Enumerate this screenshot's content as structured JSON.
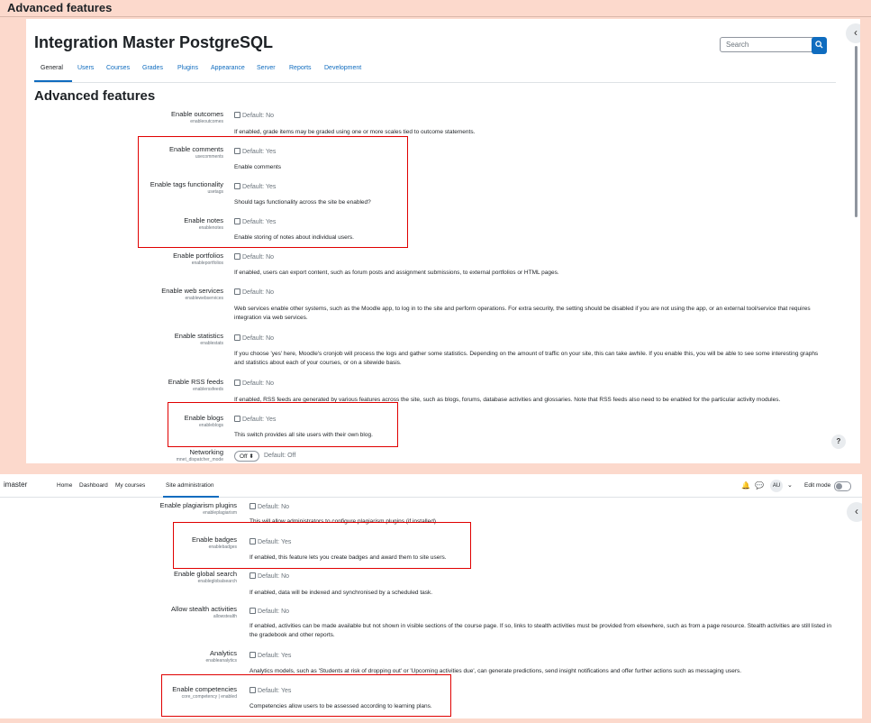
{
  "window_title": "Advanced features",
  "top": {
    "site_title": "Integration Master PostgreSQL",
    "search_placeholder": "Search",
    "tabs": [
      {
        "label": "General"
      },
      {
        "label": "Users"
      },
      {
        "label": "Courses"
      },
      {
        "label": "Grades"
      },
      {
        "label": "Plugins"
      },
      {
        "label": "Appearance"
      },
      {
        "label": "Server"
      },
      {
        "label": "Reports"
      },
      {
        "label": "Development"
      }
    ],
    "page_heading": "Advanced features",
    "settings": [
      {
        "label": "Enable outcomes",
        "key": "enableoutcomes",
        "default": "Default: No",
        "desc": "If enabled, grade items may be graded using one or more scales tied to outcome statements."
      },
      {
        "label": "Enable comments",
        "key": "usecomments",
        "default": "Default: Yes",
        "desc": "Enable comments"
      },
      {
        "label": "Enable tags functionality",
        "key": "usetags",
        "default": "Default: Yes",
        "desc": "Should tags functionality across the site be enabled?"
      },
      {
        "label": "Enable notes",
        "key": "enablenotes",
        "default": "Default: Yes",
        "desc": "Enable storing of notes about individual users."
      },
      {
        "label": "Enable portfolios",
        "key": "enableportfolios",
        "default": "Default: No",
        "desc": "If enabled, users can export content, such as forum posts and assignment submissions, to external portfolios or HTML pages."
      },
      {
        "label": "Enable web services",
        "key": "enablewebservices",
        "default": "Default: No",
        "desc": "Web services enable other systems, such as the Moodle app, to log in to the site and perform operations. For extra security, the setting should be disabled if you are not using the app, or an external tool/service that requires integration via web services."
      },
      {
        "label": "Enable statistics",
        "key": "enablestats",
        "default": "Default: No",
        "desc": "If you choose 'yes' here, Moodle's cronjob will process the logs and gather some statistics. Depending on the amount of traffic on your site, this can take awhile. If you enable this, you will be able to see some interesting graphs and statistics about each of your courses, or on a sitewide basis."
      },
      {
        "label": "Enable RSS feeds",
        "key": "enablerssfeeds",
        "default": "Default: No",
        "desc": "If enabled, RSS feeds are generated by various features across the site, such as blogs, forums, database activities and glossaries. Note that RSS feeds also need to be enabled for the particular activity modules."
      },
      {
        "label": "Enable blogs",
        "key": "enableblogs",
        "default": "Default: Yes",
        "desc": "This switch provides all site users with their own blog."
      },
      {
        "label": "Networking",
        "key": "mnet_dispatcher_mode",
        "default": "Default: Off",
        "select_value": "Off"
      }
    ],
    "help_label": "?"
  },
  "bottom": {
    "brand": "imaster",
    "nav": [
      {
        "label": "Home"
      },
      {
        "label": "Dashboard"
      },
      {
        "label": "My courses"
      },
      {
        "label": "Site administration"
      }
    ],
    "avatar": "AU",
    "edit_mode": "Edit mode",
    "settings": [
      {
        "label": "Enable plagiarism plugins",
        "key": "enableplagiarism",
        "default": "Default: No",
        "desc": "This will allow administrators to configure plagiarism plugins (if installed)"
      },
      {
        "label": "Enable badges",
        "key": "enablebadges",
        "default": "Default: Yes",
        "desc": "If enabled, this feature lets you create badges and award them to site users."
      },
      {
        "label": "Enable global search",
        "key": "enableglobalsearch",
        "default": "Default: No",
        "desc": "If enabled, data will be indexed and synchronised by a scheduled task."
      },
      {
        "label": "Allow stealth activities",
        "key": "allowstealth",
        "default": "Default: No",
        "desc": "If enabled, activities can be made available but not shown in visible sections of the course page. If so, links to stealth activities must be provided from elsewhere, such as from a page resource. Stealth activities are still listed in the gradebook and other reports."
      },
      {
        "label": "Analytics",
        "key": "enableanalytics",
        "default": "Default: Yes",
        "desc": "Analytics models, such as 'Students at risk of dropping out' or 'Upcoming activities due', can generate predictions, send insight notifications and offer further actions such as messaging users."
      },
      {
        "label": "Enable competencies",
        "key": "core_competency | enabled",
        "default": "Default: Yes",
        "desc": "Competencies allow users to be assessed according to learning plans."
      }
    ]
  }
}
